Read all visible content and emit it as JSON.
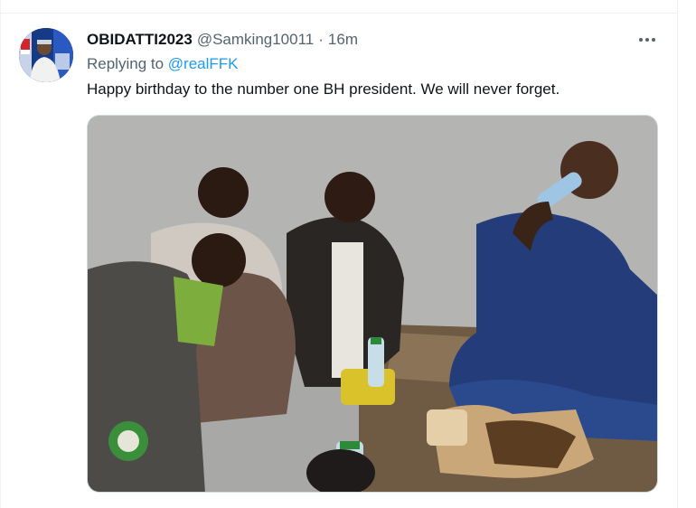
{
  "tweet": {
    "author_name": "OBIDATTI2023",
    "author_handle": "@Samking10011",
    "separator": "·",
    "timestamp": "16m",
    "replying_prefix": "Replying to",
    "replying_to": "@realFFK",
    "text": "Happy birthday to the number one BH president. We will never forget."
  },
  "icons": {
    "more": "more-horizontal-icon"
  },
  "colors": {
    "link": "#1d9bf0",
    "secondary_text": "#536471",
    "primary_text": "#0f1419"
  }
}
